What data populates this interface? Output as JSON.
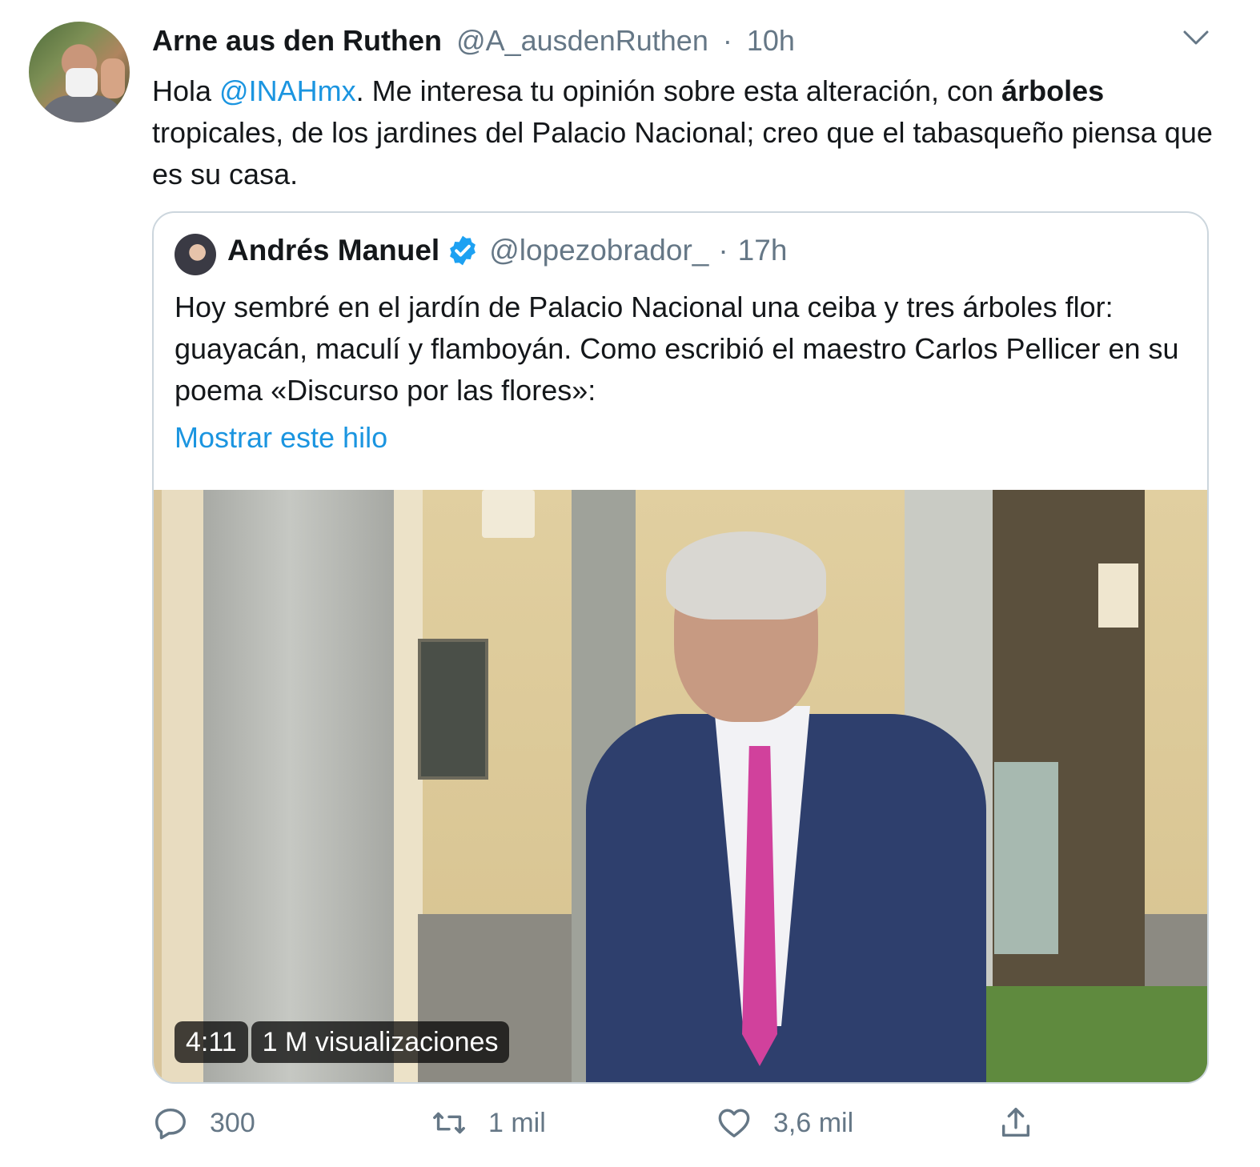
{
  "tweet": {
    "author_name": "Arne aus den Ruthen",
    "handle": "@A_ausdenRuthen",
    "separator": "·",
    "time": "10h",
    "text_parts": {
      "p1": "Hola ",
      "mention": "@INAHmx",
      "p2": ". Me interesa tu opinión sobre esta alteración, con ",
      "bold": "árboles",
      "p3": " tropicales, de los jardines del Palacio Nacional; creo que el tabasqueño piensa que es su casa."
    }
  },
  "quoted": {
    "author_name": "Andrés Manuel",
    "handle": "@lopezobrador_",
    "separator": "·",
    "time": "17h",
    "text": "Hoy sembré en el jardín de Palacio Nacional una ceiba y tres árboles flor: guayacán, maculí y flamboyán. Como escribió el maestro Carlos Pellicer en su poema «Discurso por las flores»:",
    "show_thread": "Mostrar este hilo",
    "video": {
      "duration": "4:11",
      "views": "1 M visualizaciones"
    }
  },
  "actions": {
    "reply_count": "300",
    "retweet_count": "1 mil",
    "like_count": "3,6 mil"
  },
  "icons": [
    "chevron-down-icon",
    "verified-icon",
    "reply-icon",
    "retweet-icon",
    "like-icon",
    "share-icon"
  ],
  "colors": {
    "link": "#1b95e0",
    "secondary": "#657786",
    "verified": "#1da1f2",
    "tie": "#d1419c"
  }
}
